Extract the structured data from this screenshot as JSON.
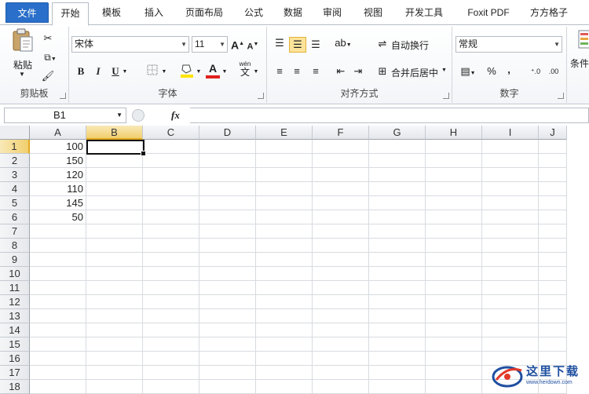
{
  "tabs": [
    {
      "label": "文件",
      "kind": "file"
    },
    {
      "label": "开始",
      "kind": "active"
    },
    {
      "label": "模板"
    },
    {
      "label": "插入"
    },
    {
      "label": "页面布局"
    },
    {
      "label": "公式"
    },
    {
      "label": "数据"
    },
    {
      "label": "审阅"
    },
    {
      "label": "视图"
    },
    {
      "label": "开发工具"
    },
    {
      "label": "Foxit PDF"
    },
    {
      "label": "方方格子"
    }
  ],
  "ribbon": {
    "clipboard": {
      "label": "剪贴板",
      "paste": "粘贴"
    },
    "font": {
      "label": "字体",
      "name": "宋体",
      "size": "11",
      "bold": "B",
      "italic": "I",
      "underline": "U",
      "grow": "A",
      "shrink": "A",
      "color_glyph": "A",
      "wen": "wén",
      "wen_char": "文"
    },
    "alignment": {
      "label": "对齐方式",
      "wrap": "自动换行",
      "merge": "合并后居中"
    },
    "number": {
      "label": "数字",
      "format": "常规",
      "percent": "%",
      "comma": ","
    },
    "conditional": {
      "label": "条件"
    }
  },
  "formula_bar": {
    "name_box": "B1",
    "fx": "fx",
    "value": ""
  },
  "columns": [
    "A",
    "B",
    "C",
    "D",
    "E",
    "F",
    "G",
    "H",
    "I",
    "J"
  ],
  "rows": [
    "1",
    "2",
    "3",
    "4",
    "5",
    "6",
    "7",
    "8",
    "9",
    "10",
    "11",
    "12",
    "13",
    "14",
    "15",
    "16",
    "17",
    "18"
  ],
  "cells": {
    "A1": "100",
    "A2": "150",
    "A3": "120",
    "A4": "110",
    "A5": "145",
    "A6": "50"
  },
  "selected_cell": "B1",
  "watermark": {
    "text": "这里下载",
    "url": "www.herdown.com"
  },
  "colors": {
    "file_tab": "#2a6fc9",
    "selection_header": "#f1cf6e",
    "font_color": "#e0201c",
    "fill_color": "#ffe400"
  }
}
